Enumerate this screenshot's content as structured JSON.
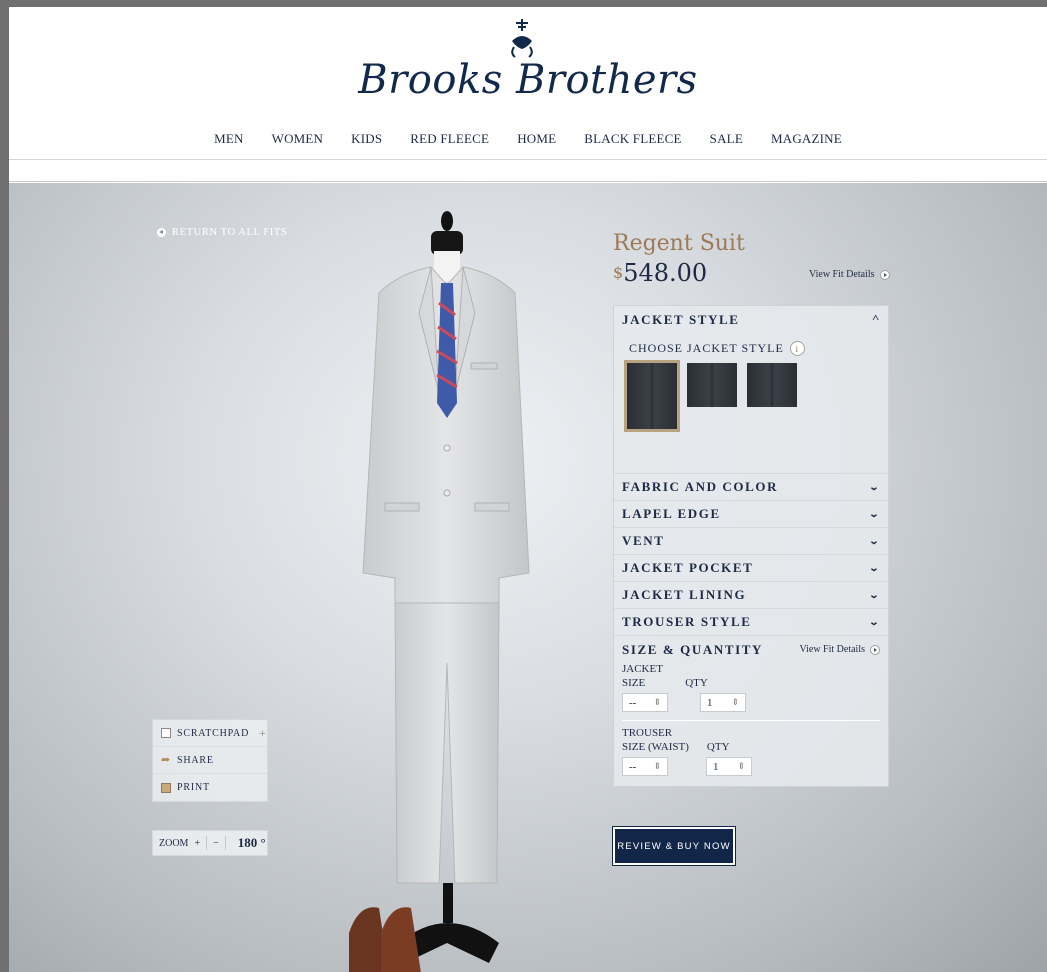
{
  "brand": {
    "logo_text": "Brooks Brothers"
  },
  "nav": {
    "items": [
      "MEN",
      "WOMEN",
      "KIDS",
      "RED FLEECE",
      "HOME",
      "BLACK FLEECE",
      "SALE",
      "MAGAZINE"
    ]
  },
  "stage": {
    "return_label": "RETURN TO ALL FITS",
    "tools": {
      "scratchpad": "SCRATCHPAD",
      "share": "SHARE",
      "print": "PRINT"
    },
    "zoom": {
      "label": "ZOOM",
      "plus": "+",
      "minus": "−",
      "rotation": "180 °"
    }
  },
  "product": {
    "title": "Regent Suit",
    "currency": "$",
    "price": "548.00",
    "fit_details_label": "View Fit Details"
  },
  "panel": {
    "jacket_style": {
      "title": "JACKET STYLE",
      "choose_label": "CHOOSE JACKET STYLE",
      "info_glyph": "i",
      "selected_index": 0
    },
    "sections": [
      "FABRIC AND COLOR",
      "LAPEL EDGE",
      "VENT",
      "JACKET POCKET",
      "JACKET LINING",
      "TROUSER STYLE"
    ],
    "size_quantity": {
      "title": "SIZE & QUANTITY",
      "fit_details_label": "View Fit Details",
      "jacket": {
        "heading": "JACKET",
        "size_label": "SIZE",
        "qty_label": "QTY",
        "size_value": "--",
        "qty_value": "1"
      },
      "trouser": {
        "heading": "TROUSER",
        "size_label": "SIZE (WAIST)",
        "qty_label": "QTY",
        "size_value": "--",
        "qty_value": "1"
      }
    }
  },
  "cta": {
    "label": "REVIEW & BUY NOW"
  },
  "colors": {
    "navy": "#12264a",
    "gold": "#9c7a55",
    "swatch_border": "#b9a27f"
  }
}
